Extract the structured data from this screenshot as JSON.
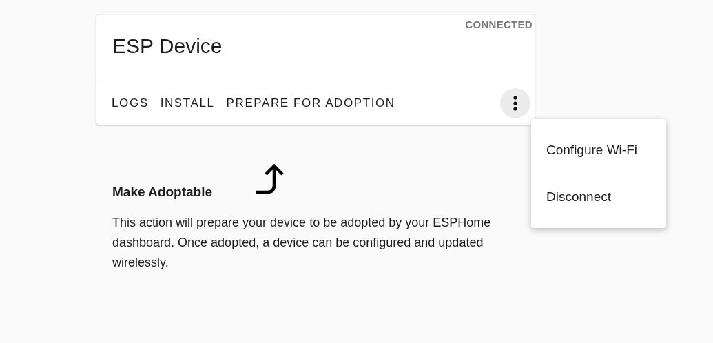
{
  "card": {
    "title": "ESP Device",
    "status": "CONNECTED",
    "actions": [
      "LOGS",
      "INSTALL",
      "PREPARE FOR ADOPTION"
    ]
  },
  "menu": {
    "open": true,
    "items": [
      "Configure Wi-Fi",
      "Disconnect"
    ]
  },
  "section": {
    "heading": "Make Adoptable",
    "text": "This action will prepare your device to be adopted by your ESPHome dashboard. Once adopted, a device can be configured and updated wirelessly."
  }
}
